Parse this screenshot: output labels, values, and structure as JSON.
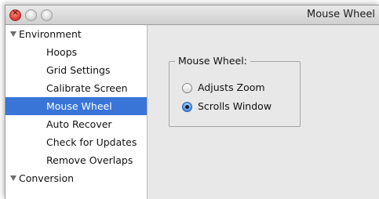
{
  "window": {
    "title": "Mouse Wheel"
  },
  "sidebar": {
    "groups": [
      {
        "label": "Environment",
        "items": [
          {
            "label": "Hoops"
          },
          {
            "label": "Grid Settings"
          },
          {
            "label": "Calibrate Screen"
          },
          {
            "label": "Mouse Wheel",
            "selected": true
          },
          {
            "label": "Auto Recover"
          },
          {
            "label": "Check for Updates"
          },
          {
            "label": "Remove Overlaps"
          }
        ]
      },
      {
        "label": "Conversion",
        "items": []
      }
    ]
  },
  "panel": {
    "group_label": "Mouse Wheel:",
    "options": [
      {
        "label": "Adjusts Zoom",
        "checked": false
      },
      {
        "label": "Scrolls Window",
        "checked": true
      }
    ]
  },
  "colors": {
    "selection": "#3875d7",
    "panel_background": "#e8e8e8",
    "close_button": "#e3443a"
  },
  "icons": {
    "close": "close-icon",
    "minimize": "minimize-icon",
    "zoom": "zoom-icon",
    "disclosure": "disclosure-triangle-icon"
  }
}
